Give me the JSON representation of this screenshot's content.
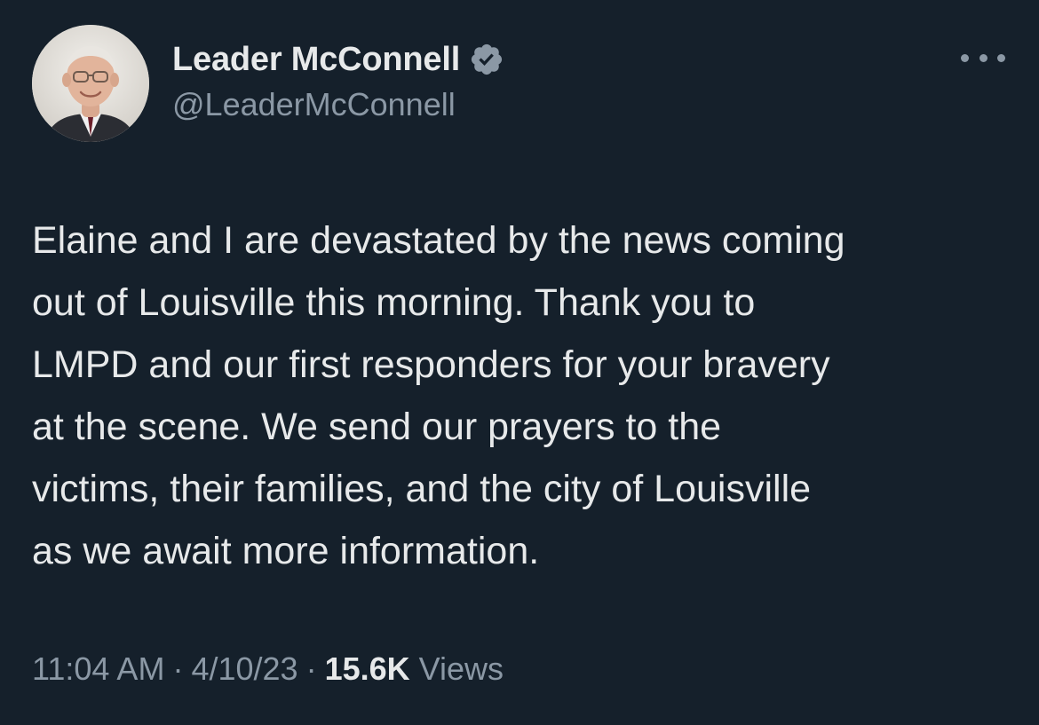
{
  "author": {
    "display_name": "Leader McConnell",
    "handle": "@LeaderMcConnell",
    "verified": true,
    "avatar_icon": "profile-photo"
  },
  "menu": {
    "icon": "more-options-icon"
  },
  "tweet": {
    "text_lines": [
      "Elaine and I are devastated by the news coming",
      "out of Louisville this morning. Thank you to",
      "LMPD and our first responders for your bravery",
      "at the scene. We send our prayers to the",
      "victims, their families, and the city of Louisville",
      "as we await more information."
    ]
  },
  "meta": {
    "time": "11:04 AM",
    "separator": "·",
    "date": "4/10/23",
    "views_count": "15.6K",
    "views_label": "Views"
  },
  "colors": {
    "background": "#15202b",
    "primary_text": "#e7e9ea",
    "secondary_text": "#8b98a5",
    "badge": "#8b98a5"
  }
}
